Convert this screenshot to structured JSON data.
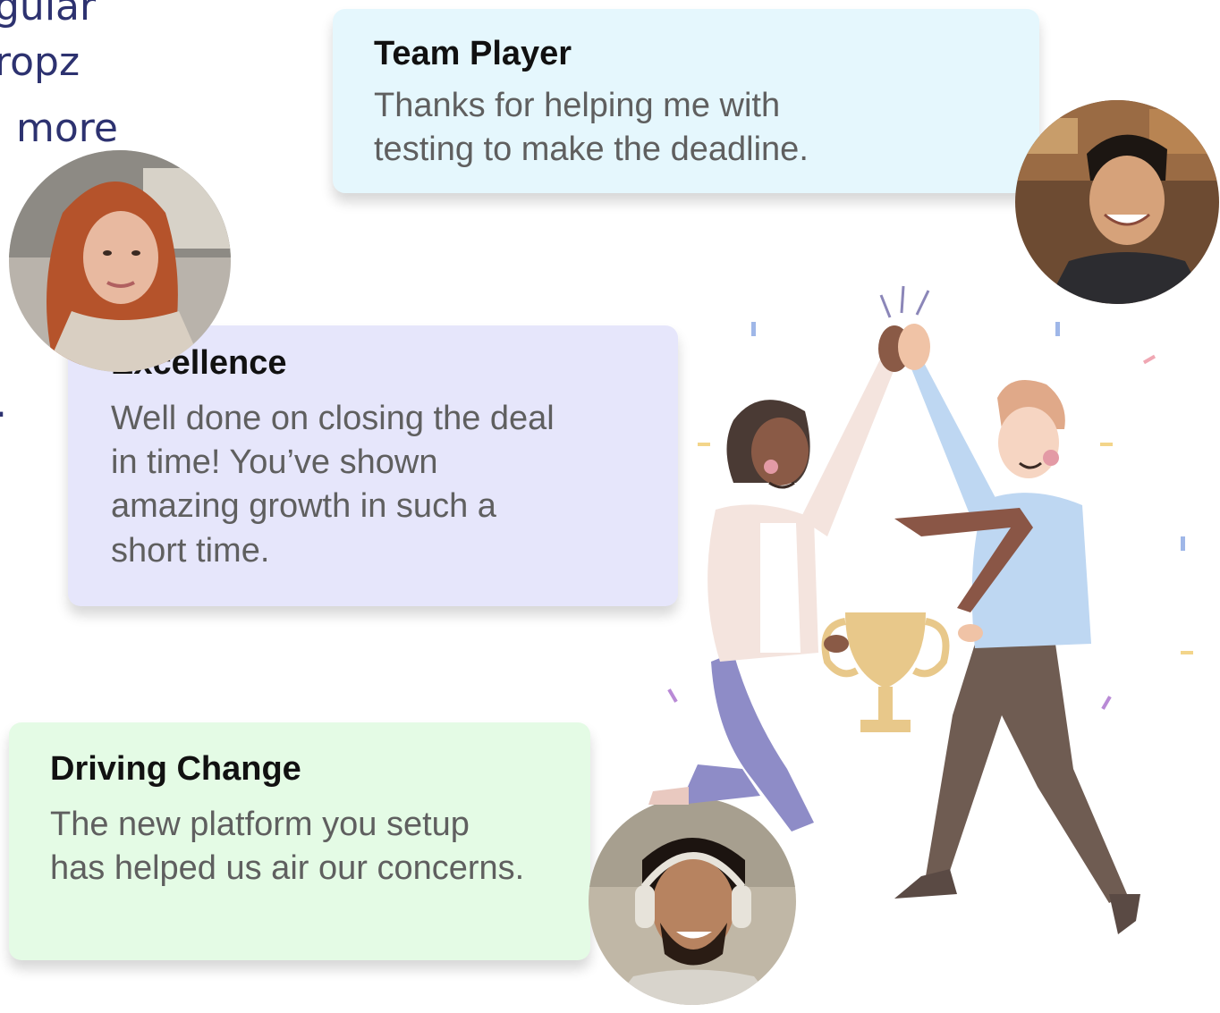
{
  "background_text": [
    "gular",
    "ropz",
    "more",
    "."
  ],
  "cards": [
    {
      "title": "Team Player",
      "body_lines": [
        "Thanks for helping me with",
        "testing to make the deadline."
      ],
      "bg": "#e5f7fd"
    },
    {
      "title": "Excellence",
      "body_lines": [
        "Well done on closing the deal",
        "in time! You’ve shown",
        "amazing growth in such a",
        "short time."
      ],
      "bg": "#e6e6fb"
    },
    {
      "title": "Driving Change",
      "body_lines": [
        "The new platform you setup",
        "has helped us air our concerns."
      ],
      "bg": "#e4fbe5"
    }
  ],
  "colors": {
    "text_dark": "#111111",
    "text_body": "#5f5f5f",
    "bg_text": "#2d3270"
  }
}
